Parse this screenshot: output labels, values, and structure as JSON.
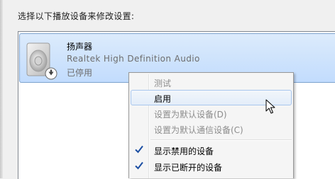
{
  "instruction": "选择以下播放设备来修改设置:",
  "device": {
    "name": "扬声器",
    "driver": "Realtek High Definition Audio",
    "status": "已停用",
    "icon": "speaker-icon",
    "overlay_icon": "disabled-down-arrow-icon"
  },
  "context_menu": {
    "items": [
      {
        "label": "测试",
        "enabled": false
      },
      {
        "label": "启用",
        "enabled": true,
        "highlighted": true
      },
      {
        "label": "设置为默认设备(D)",
        "enabled": false
      },
      {
        "label": "设置为默认通信设备(C)",
        "enabled": false
      },
      {
        "label": "显示禁用的设备",
        "enabled": true,
        "checked": true
      },
      {
        "label": "显示已断开的设备",
        "enabled": true,
        "checked": true
      }
    ]
  },
  "colors": {
    "selection_bg": "#c9e0fc",
    "selection_border": "#7da2ce",
    "check": "#1b4ea3",
    "disabled_text": "#8d8d8d"
  }
}
